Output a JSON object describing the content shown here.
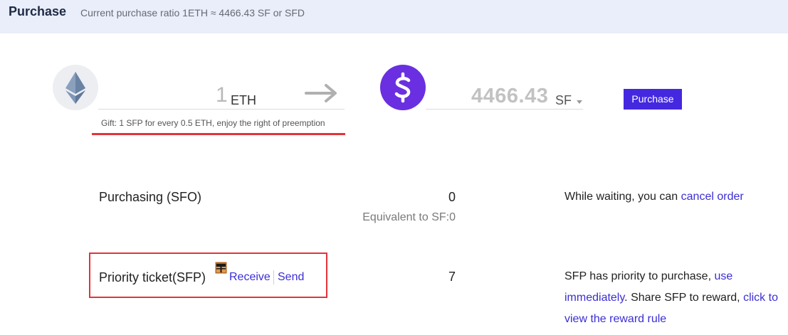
{
  "header": {
    "title": "Purchase",
    "ratio_text": "Current purchase ratio 1ETH ≈ 4466.43 SF or SFD"
  },
  "converter": {
    "eth_amount": "1",
    "eth_unit": "ETH",
    "gift_note": "Gift: 1 SFP for every 0.5 ETH, enjoy the right of preemption",
    "sf_amount": "4466.43",
    "sf_unit": "SF",
    "purchase_label": "Purchase",
    "eth_icon": "ethereum-icon",
    "sf_icon": "dollar-sign-icon",
    "arrow_icon": "arrow-right-icon",
    "accent": "#4428e0",
    "sf_logo_color": "#6a2fe0"
  },
  "purchasing": {
    "label": "Purchasing (SFO)",
    "value": "0",
    "equivalent": "Equivalent to SF:0",
    "note_prefix": "While waiting, you can ",
    "note_link": "cancel order"
  },
  "priority": {
    "label": "Priority ticket(SFP)",
    "receive_link": "Receive",
    "send_link": "Send",
    "value": "7",
    "note_part1": "SFP has priority to purchase, ",
    "note_link1": "use immediately",
    "note_part2": ". Share SFP to reward, ",
    "note_link2": "click to view the reward rule",
    "gift_icon": "gift-icon",
    "highlight_color": "#e4333a"
  }
}
